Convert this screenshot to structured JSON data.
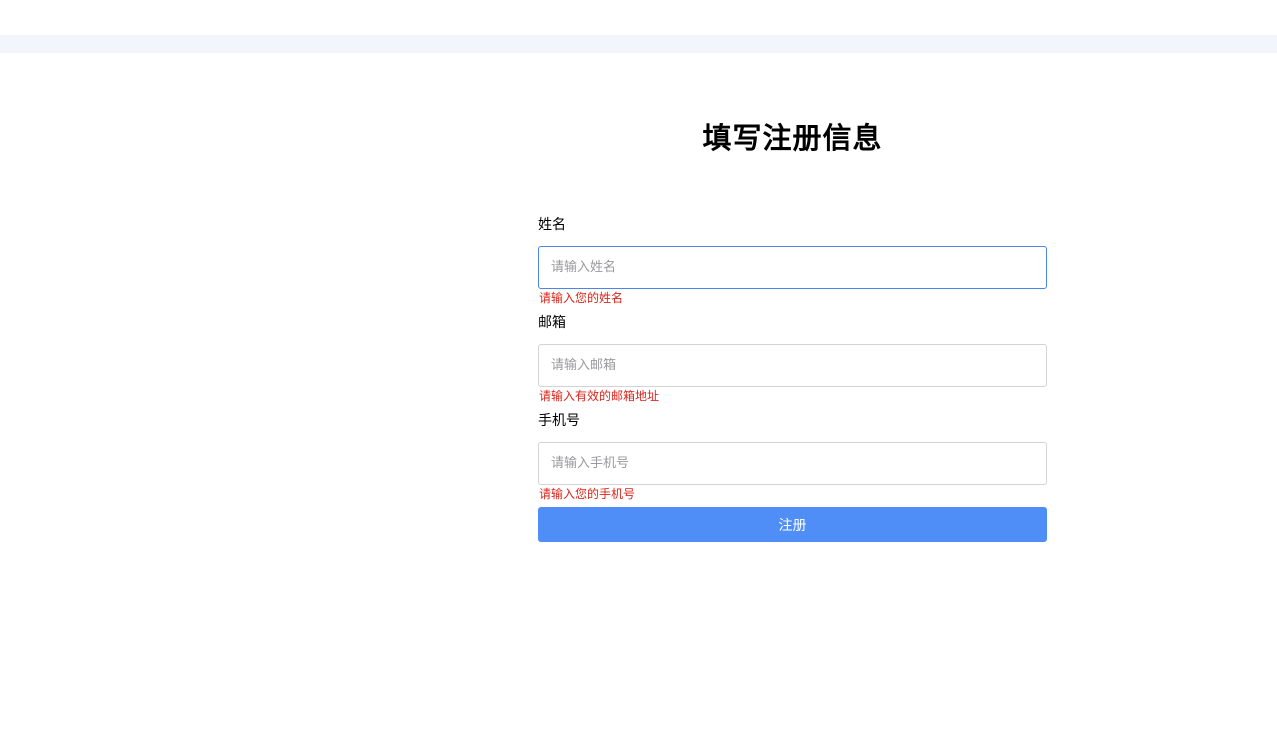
{
  "page": {
    "title": "填写注册信息"
  },
  "form": {
    "name": {
      "label": "姓名",
      "placeholder": "请输入姓名",
      "value": "",
      "error": "请输入您的姓名"
    },
    "email": {
      "label": "邮箱",
      "placeholder": "请输入邮箱",
      "value": "",
      "error": "请输入有效的邮箱地址"
    },
    "phone": {
      "label": "手机号",
      "placeholder": "请输入手机号",
      "value": "",
      "error": "请输入您的手机号"
    },
    "submit_label": "注册"
  },
  "colors": {
    "accent": "#4f8ef7",
    "error": "#d9261c",
    "focus_border": "#4a86e8",
    "top_band": "#f2f5fc"
  }
}
